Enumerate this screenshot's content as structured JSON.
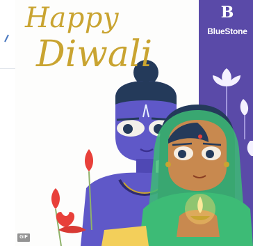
{
  "banner": {
    "greeting_line1": "Happy",
    "greeting_line2": "Diwali",
    "brand_mark": "B",
    "brand_name": "BlueStone",
    "media_badge": "GIF"
  },
  "colors": {
    "gold": "#c9a431",
    "purple_panel": "#5a4aa8",
    "character_blue": "#5f58c8",
    "skin": "#c8894f",
    "green_dupatta": "#3dbb76",
    "lotus_red": "#e8403a"
  },
  "icons": {
    "brand_logo": "bluestone-b-logo",
    "badge": "gif-badge"
  }
}
